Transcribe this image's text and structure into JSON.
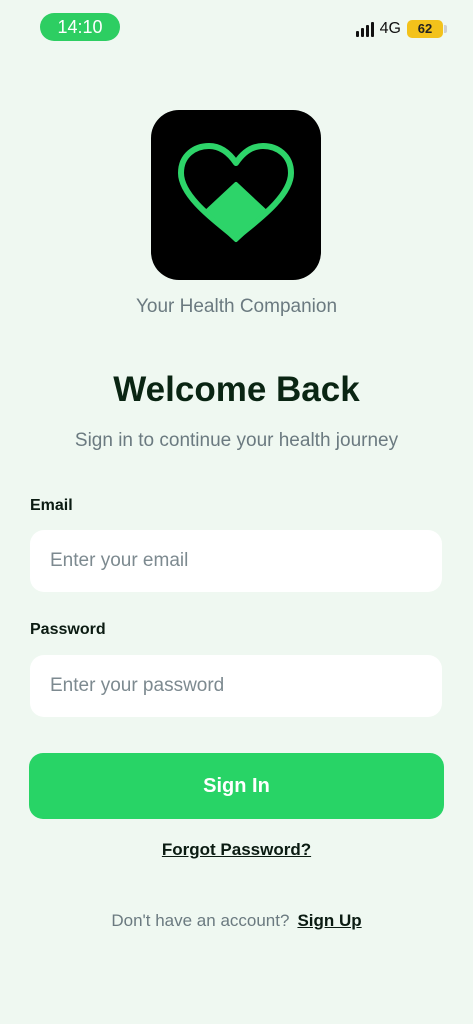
{
  "status_bar": {
    "time": "14:10",
    "network": "4G",
    "battery": "62"
  },
  "brand": {
    "tagline": "Your Health Companion"
  },
  "login": {
    "title": "Welcome Back",
    "subtitle": "Sign in to continue your health journey",
    "email_label": "Email",
    "email_placeholder": "Enter your email",
    "password_label": "Password",
    "password_placeholder": "Enter your password",
    "sign_in_label": "Sign In",
    "forgot_label": "Forgot Password?",
    "no_account_text": "Don't have an account?",
    "sign_up_label": "Sign Up"
  },
  "colors": {
    "accent": "#28d466",
    "background": "#eff8f1"
  }
}
